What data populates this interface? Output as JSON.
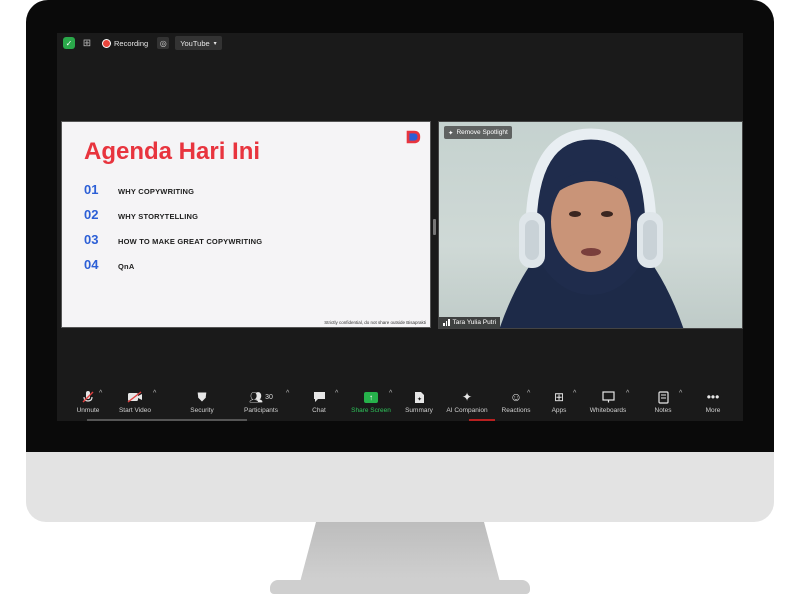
{
  "topbar": {
    "recording_label": "Recording",
    "stream_label": "YouTube"
  },
  "slide": {
    "title": "Agenda Hari Ini",
    "items": [
      {
        "num": "01",
        "text": "WHY COPYWRITING"
      },
      {
        "num": "02",
        "text": "WHY STORYTELLING"
      },
      {
        "num": "03",
        "text": "HOW TO MAKE GREAT COPYWRITING"
      },
      {
        "num": "04",
        "text": "QnA"
      }
    ],
    "footer": "Strictly confidential, do not share outside Bisaprakti"
  },
  "video": {
    "spotlight_label": "Remove Spotlight",
    "participant_name": "Tara Yulia Putri"
  },
  "toolbar": {
    "unmute": "Unmute",
    "start_video": "Start Video",
    "security": "Security",
    "participants": "Participants",
    "participants_count": "30",
    "chat": "Chat",
    "share_screen": "Share Screen",
    "summary": "Summary",
    "ai_companion": "AI Companion",
    "reactions": "Reactions",
    "apps": "Apps",
    "whiteboards": "Whiteboards",
    "notes": "Notes",
    "more": "More"
  },
  "colors": {
    "title_red": "#e8343e",
    "number_blue": "#2c5fd6",
    "share_green": "#26b24b"
  }
}
